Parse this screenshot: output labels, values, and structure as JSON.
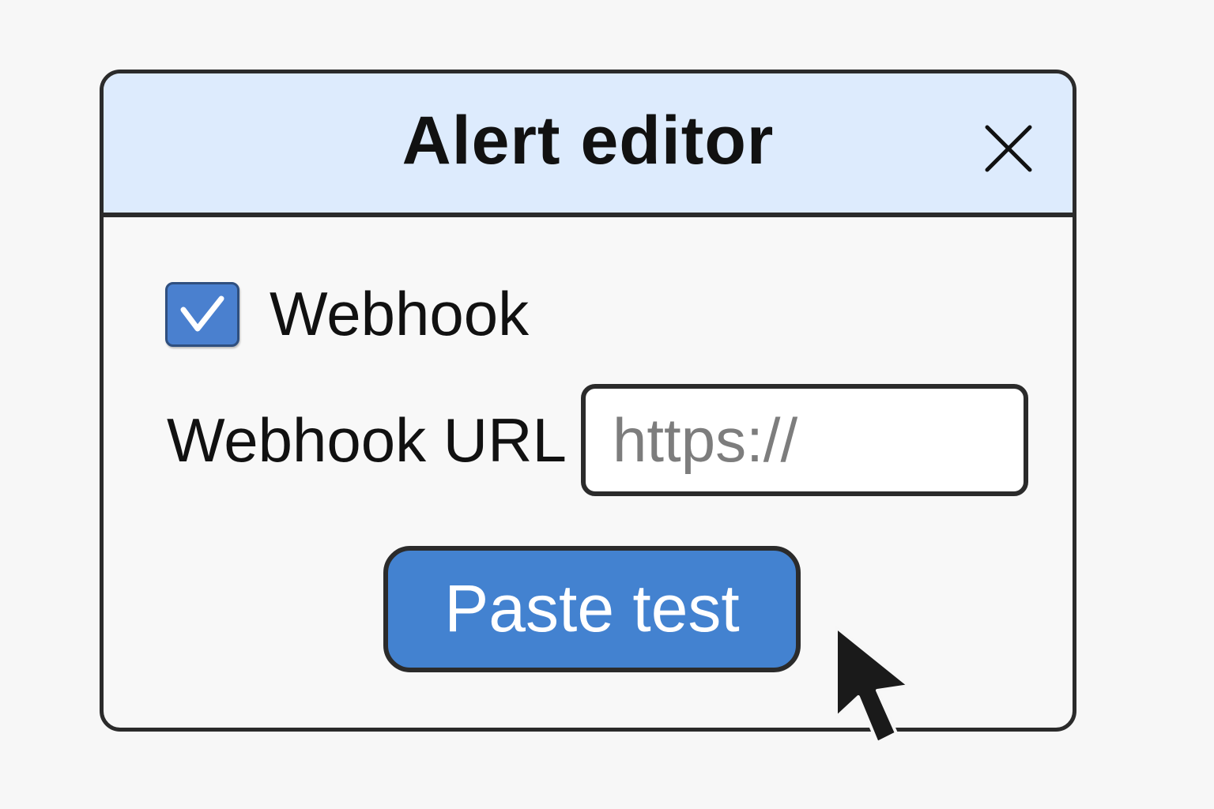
{
  "dialog": {
    "title": "Alert editor",
    "close_icon": "close-icon"
  },
  "webhook": {
    "checkbox_label": "Webhook",
    "checked": true,
    "check_icon": "checkmark-icon"
  },
  "url_field": {
    "label": "Webhook URL",
    "placeholder": "https://",
    "value": ""
  },
  "actions": {
    "paste_test_label": "Paste test"
  },
  "pointer": {
    "icon": "mouse-pointer-icon"
  },
  "colors": {
    "titlebar_bg": "#ddebfd",
    "accent": "#4382d0",
    "border": "#2b2b2b"
  }
}
